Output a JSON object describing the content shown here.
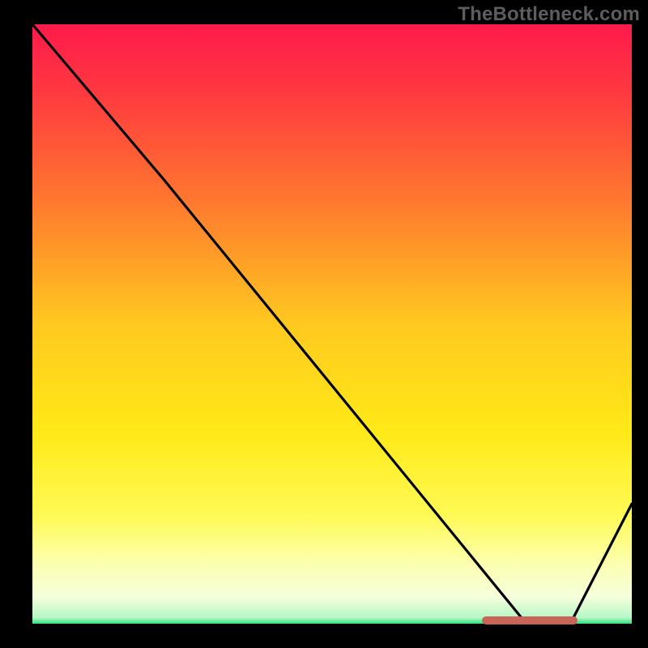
{
  "watermark": "TheBottleneck.com",
  "chart_data": {
    "type": "line",
    "title": "",
    "xlabel": "",
    "ylabel": "",
    "xlim": [
      0,
      100
    ],
    "ylim": [
      0,
      100
    ],
    "x": [
      0,
      22,
      82,
      90,
      100
    ],
    "values": [
      100,
      74,
      0.5,
      0.5,
      20
    ],
    "gradient_stops": [
      {
        "offset": 0.0,
        "color": "#ff1a4b"
      },
      {
        "offset": 0.12,
        "color": "#ff3b3f"
      },
      {
        "offset": 0.3,
        "color": "#ff7a2e"
      },
      {
        "offset": 0.5,
        "color": "#ffc91f"
      },
      {
        "offset": 0.68,
        "color": "#ffe917"
      },
      {
        "offset": 0.82,
        "color": "#fffa55"
      },
      {
        "offset": 0.9,
        "color": "#fcffb0"
      },
      {
        "offset": 0.955,
        "color": "#f5ffdb"
      },
      {
        "offset": 0.99,
        "color": "#b6f7c8"
      },
      {
        "offset": 1.0,
        "color": "#2fe07a"
      }
    ],
    "marker": {
      "x_start": 75,
      "x_end": 91,
      "y": 0.6,
      "color": "#c96459"
    }
  }
}
